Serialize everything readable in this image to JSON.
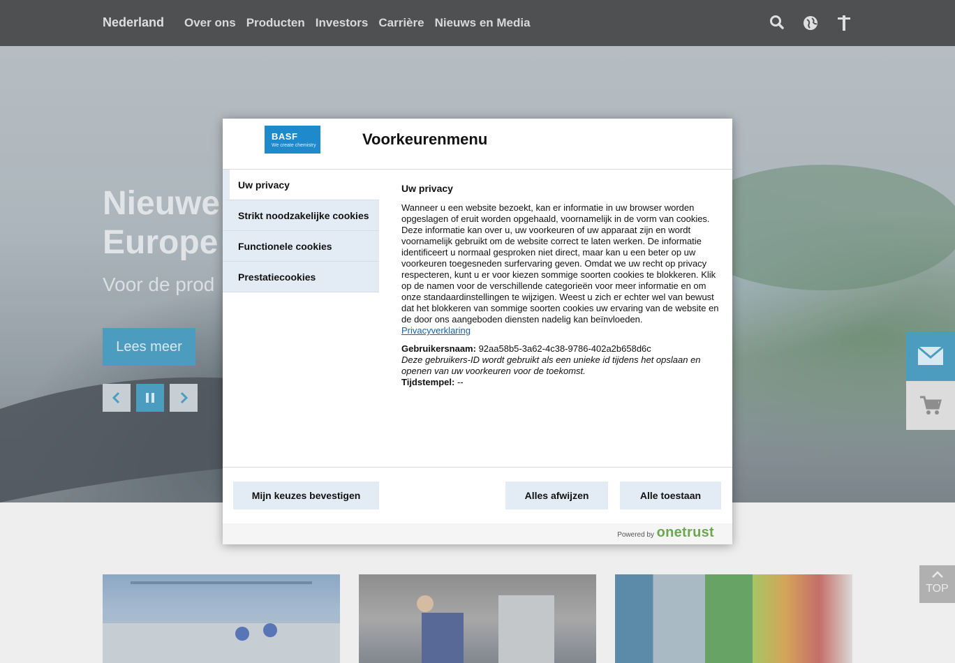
{
  "nav": {
    "brand": "Nederland",
    "items": [
      "Over ons",
      "Producten",
      "Investors",
      "Carrière",
      "Nieuws en Media"
    ],
    "icons": [
      "search-icon",
      "globe-icon",
      "accessibility-icon"
    ]
  },
  "hero": {
    "title": "Nieuwe\nEurope",
    "subtitle": "Voor de prod",
    "cta": "Lees meer",
    "controls": [
      "chevron-left-icon",
      "pause-icon",
      "chevron-right-icon"
    ]
  },
  "side": {
    "top_label": "TOP"
  },
  "modal": {
    "logo_text": "BASF",
    "logo_tagline": "We create chemistry",
    "title": "Voorkeurenmenu",
    "tabs": [
      {
        "label": "Uw privacy"
      },
      {
        "label": "Strikt noodzakelijke cookies"
      },
      {
        "label": "Functionele cookies"
      },
      {
        "label": "Prestatiecookies"
      }
    ],
    "content": {
      "heading": "Uw privacy",
      "body": "Wanneer u een website bezoekt, kan er informatie in uw browser worden opgeslagen of eruit worden opgehaald, voornamelijk in de vorm van cookies. Deze informatie kan over u, uw voorkeuren of uw apparaat zijn en wordt voornamelijk gebruikt om de website correct te laten werken. De informatie identificeert u normaal gesproken niet direct, maar kan u een beter op uw voorkeuren toegesneden surfervaring geven. Omdat we uw recht op privacy respecteren, kunt u er voor kiezen sommige soorten cookies te blokkeren. Klik op de namen voor de verschillende categorieën voor meer informatie en om onze standaardinstellingen te wijzigen. Weest u zich er echter wel van bewust dat het blokkeren van sommige soorten cookies uw ervaring van de website en de door ons aangeboden diensten nadelig kan beïnvloeden.",
      "link": "Privacyverklaring",
      "username_label": "Gebruikersnaam:",
      "username_value": "92aa58b5-3a62-4c38-9786-402a2b658d6c",
      "username_note": "Deze gebruikers-ID wordt gebruikt als een unieke id tijdens het opslaan en openen van uw voorkeuren voor de toekomst.",
      "timestamp_label": "Tijdstempel:",
      "timestamp_value": "--"
    },
    "buttons": {
      "confirm": "Mijn keuzes bevestigen",
      "reject": "Alles afwijzen",
      "accept": "Alle toestaan"
    },
    "powered_by": "Powered by",
    "powered_brand": "onetrust"
  },
  "colors": {
    "accent": "#1a80ad",
    "nav_bg": "#1d1f22",
    "tab_bg": "#e3ecf4"
  }
}
